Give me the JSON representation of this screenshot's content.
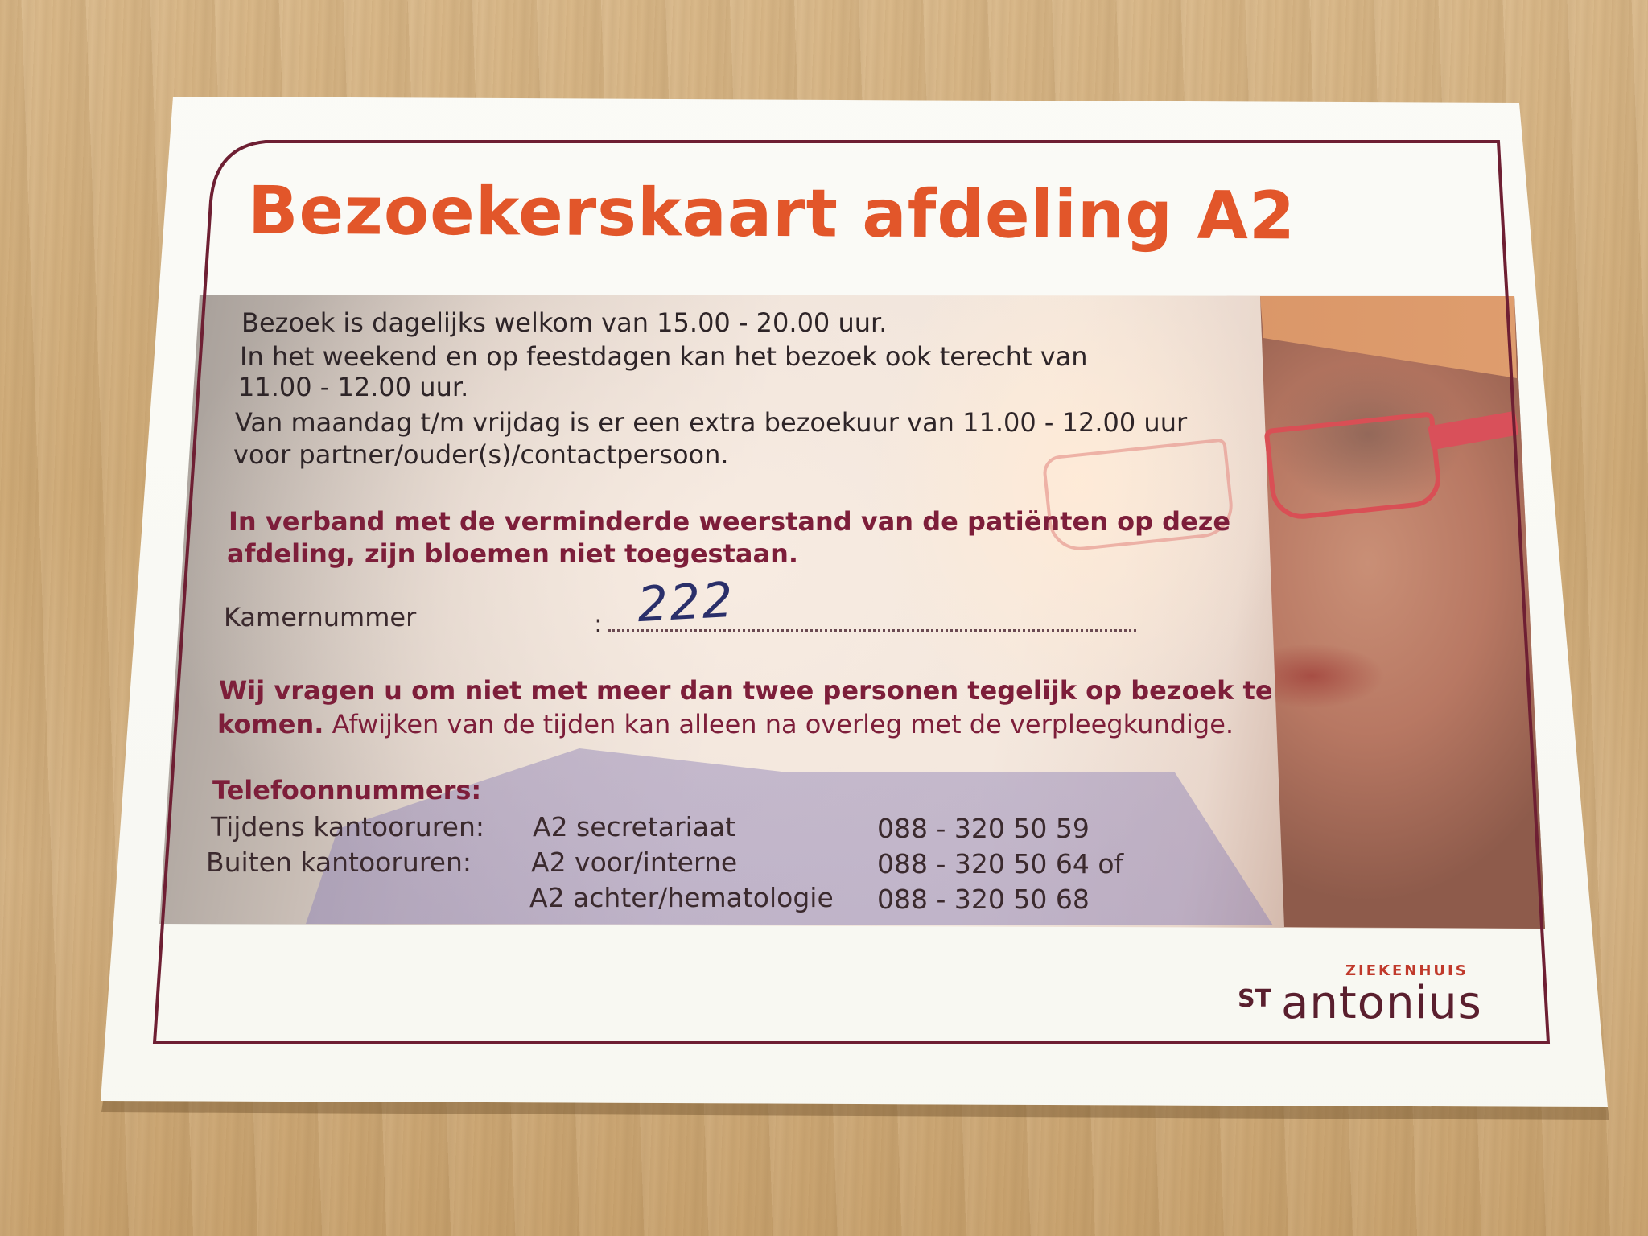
{
  "card": {
    "title": "Bezoekerskaart afdeling A2",
    "visiting": {
      "line1": "Bezoek is dagelijks welkom van 15.00 - 20.00 uur.",
      "line2": "In het weekend en op feestdagen kan het bezoek ook terecht van",
      "line3": "11.00 - 12.00 uur.",
      "line4": "Van maandag t/m vrijdag is er een extra bezoekuur van 11.00 - 12.00  uur",
      "line5": "voor partner/ouder(s)/contactpersoon."
    },
    "flowers_notice": {
      "line1": "In verband met de verminderde weerstand van de patiënten op deze",
      "line2": "afdeling, zijn bloemen niet toegestaan."
    },
    "room": {
      "label": "Kamernummer",
      "separator": ":",
      "handwritten_value": "222"
    },
    "visitor_limit": {
      "line1_bold": "Wij vragen u om niet met meer dan twee personen tegelijk op bezoek te",
      "line2_bold": "komen.",
      "line2_rest": " Afwijken van de tijden kan alleen na overleg met de verpleegkundige."
    },
    "phones": {
      "heading": "Telefoonnummers:",
      "rows": [
        {
          "label": "Tijdens kantooruren:",
          "dept": "A2 secretariaat",
          "number": "088 - 320 50 59"
        },
        {
          "label": "Buiten kantooruren:",
          "dept": "A2 voor/interne",
          "number": "088 - 320 50 64 of"
        },
        {
          "label": "",
          "dept": "A2 achter/hematologie",
          "number": "088 - 320 50 68"
        }
      ]
    },
    "logo": {
      "small": "ZIEKENHUIS",
      "st": "ST",
      "name": "antonius"
    },
    "colors": {
      "title": "#e2562a",
      "frame": "#6e1f33",
      "accent_text": "#7d1e3a",
      "handwriting": "#2a2f6a"
    }
  }
}
